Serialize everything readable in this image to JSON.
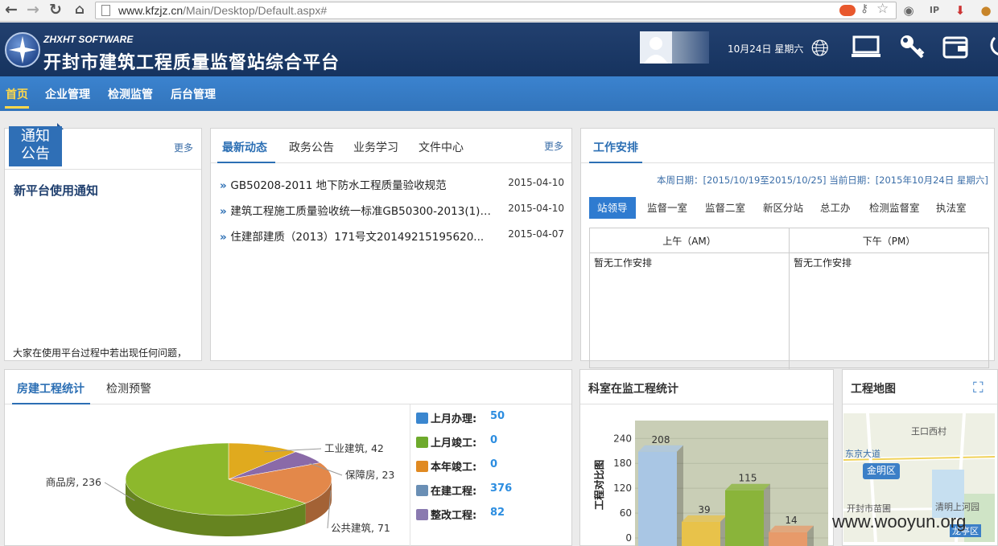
{
  "browser": {
    "url_host": "www.kfzjz.cn",
    "url_path": "/Main/Desktop/Default.aspx#"
  },
  "header": {
    "brand_sub": "ZHXHT SOFTWARE",
    "title": "开封市建筑工程质量监督站综合平台",
    "date": "10月24日  星期六"
  },
  "nav": {
    "items": [
      "首页",
      "企业管理",
      "检测监管",
      "后台管理"
    ]
  },
  "notice": {
    "badge_line1": "通知",
    "badge_line2": "公告",
    "more": "更多",
    "title": "新平台使用通知",
    "body": "大家在使用平台过程中若出现任何问题，"
  },
  "news": {
    "tabs": [
      "最新动态",
      "政务公告",
      "业务学习",
      "文件中心"
    ],
    "more": "更多",
    "items": [
      {
        "title": "GB50208-2011 地下防水工程质量验收规范",
        "date": "2015-04-10"
      },
      {
        "title": "建筑工程施工质量验收统一标准GB50300-2013(1)2...",
        "date": "2015-04-10"
      },
      {
        "title": "住建部建质（2013）171号文20149215195620...",
        "date": "2015-04-07"
      }
    ]
  },
  "schedule": {
    "tab": "工作安排",
    "range": "本周日期：[2015/10/19至2015/10/25] 当前日期：[2015年10月24日  星期六]",
    "depts": [
      "站领导",
      "监督一室",
      "监督二室",
      "新区分站",
      "总工办",
      "检测监督室",
      "执法室"
    ],
    "am_header": "上午（AM）",
    "pm_header": "下午（PM）",
    "am_value": "暂无工作安排",
    "pm_value": "暂无工作安排"
  },
  "stats": {
    "tabs": [
      "房建工程统计",
      "检测预警"
    ],
    "rows": [
      {
        "label": "上月办理:",
        "value": "50",
        "color": "#3a86cf"
      },
      {
        "label": "上月竣工:",
        "value": "0",
        "color": "#6eaa2c"
      },
      {
        "label": "本年竣工:",
        "value": "0",
        "color": "#e08a22"
      },
      {
        "label": "在建工程:",
        "value": "376",
        "color": "#6a8fb5"
      },
      {
        "label": "整改工程:",
        "value": "82",
        "color": "#8a7ab0"
      }
    ]
  },
  "chart_data": [
    {
      "type": "pie",
      "labels": [
        "商品房",
        "工业建筑",
        "保障房",
        "公共建筑"
      ],
      "values": [
        236,
        42,
        23,
        71
      ],
      "label_texts": [
        "商品房, 236",
        "工业建筑, 42",
        "保障房, 23",
        "公共建筑, 71"
      ],
      "colors": [
        "#8db82c",
        "#e0aa1e",
        "#8a6aa8",
        "#e3884a"
      ]
    },
    {
      "type": "bar",
      "title": "科室在监工程统计",
      "ylabel": "工程对比图",
      "ticks": [
        0,
        60,
        120,
        180,
        240
      ],
      "ylim": [
        0,
        260
      ],
      "values": [
        208,
        39,
        115,
        14
      ],
      "colors": [
        "#a9c6e4",
        "#e8c24a",
        "#8ab43a",
        "#e79a6a"
      ]
    }
  ],
  "map": {
    "title": "工程地图",
    "labels": [
      "王口西村",
      "东京大道",
      "金明区",
      "开封市苗圃",
      "清明上河园",
      "龙亭区"
    ]
  },
  "watermark": "www.wooyun.org"
}
